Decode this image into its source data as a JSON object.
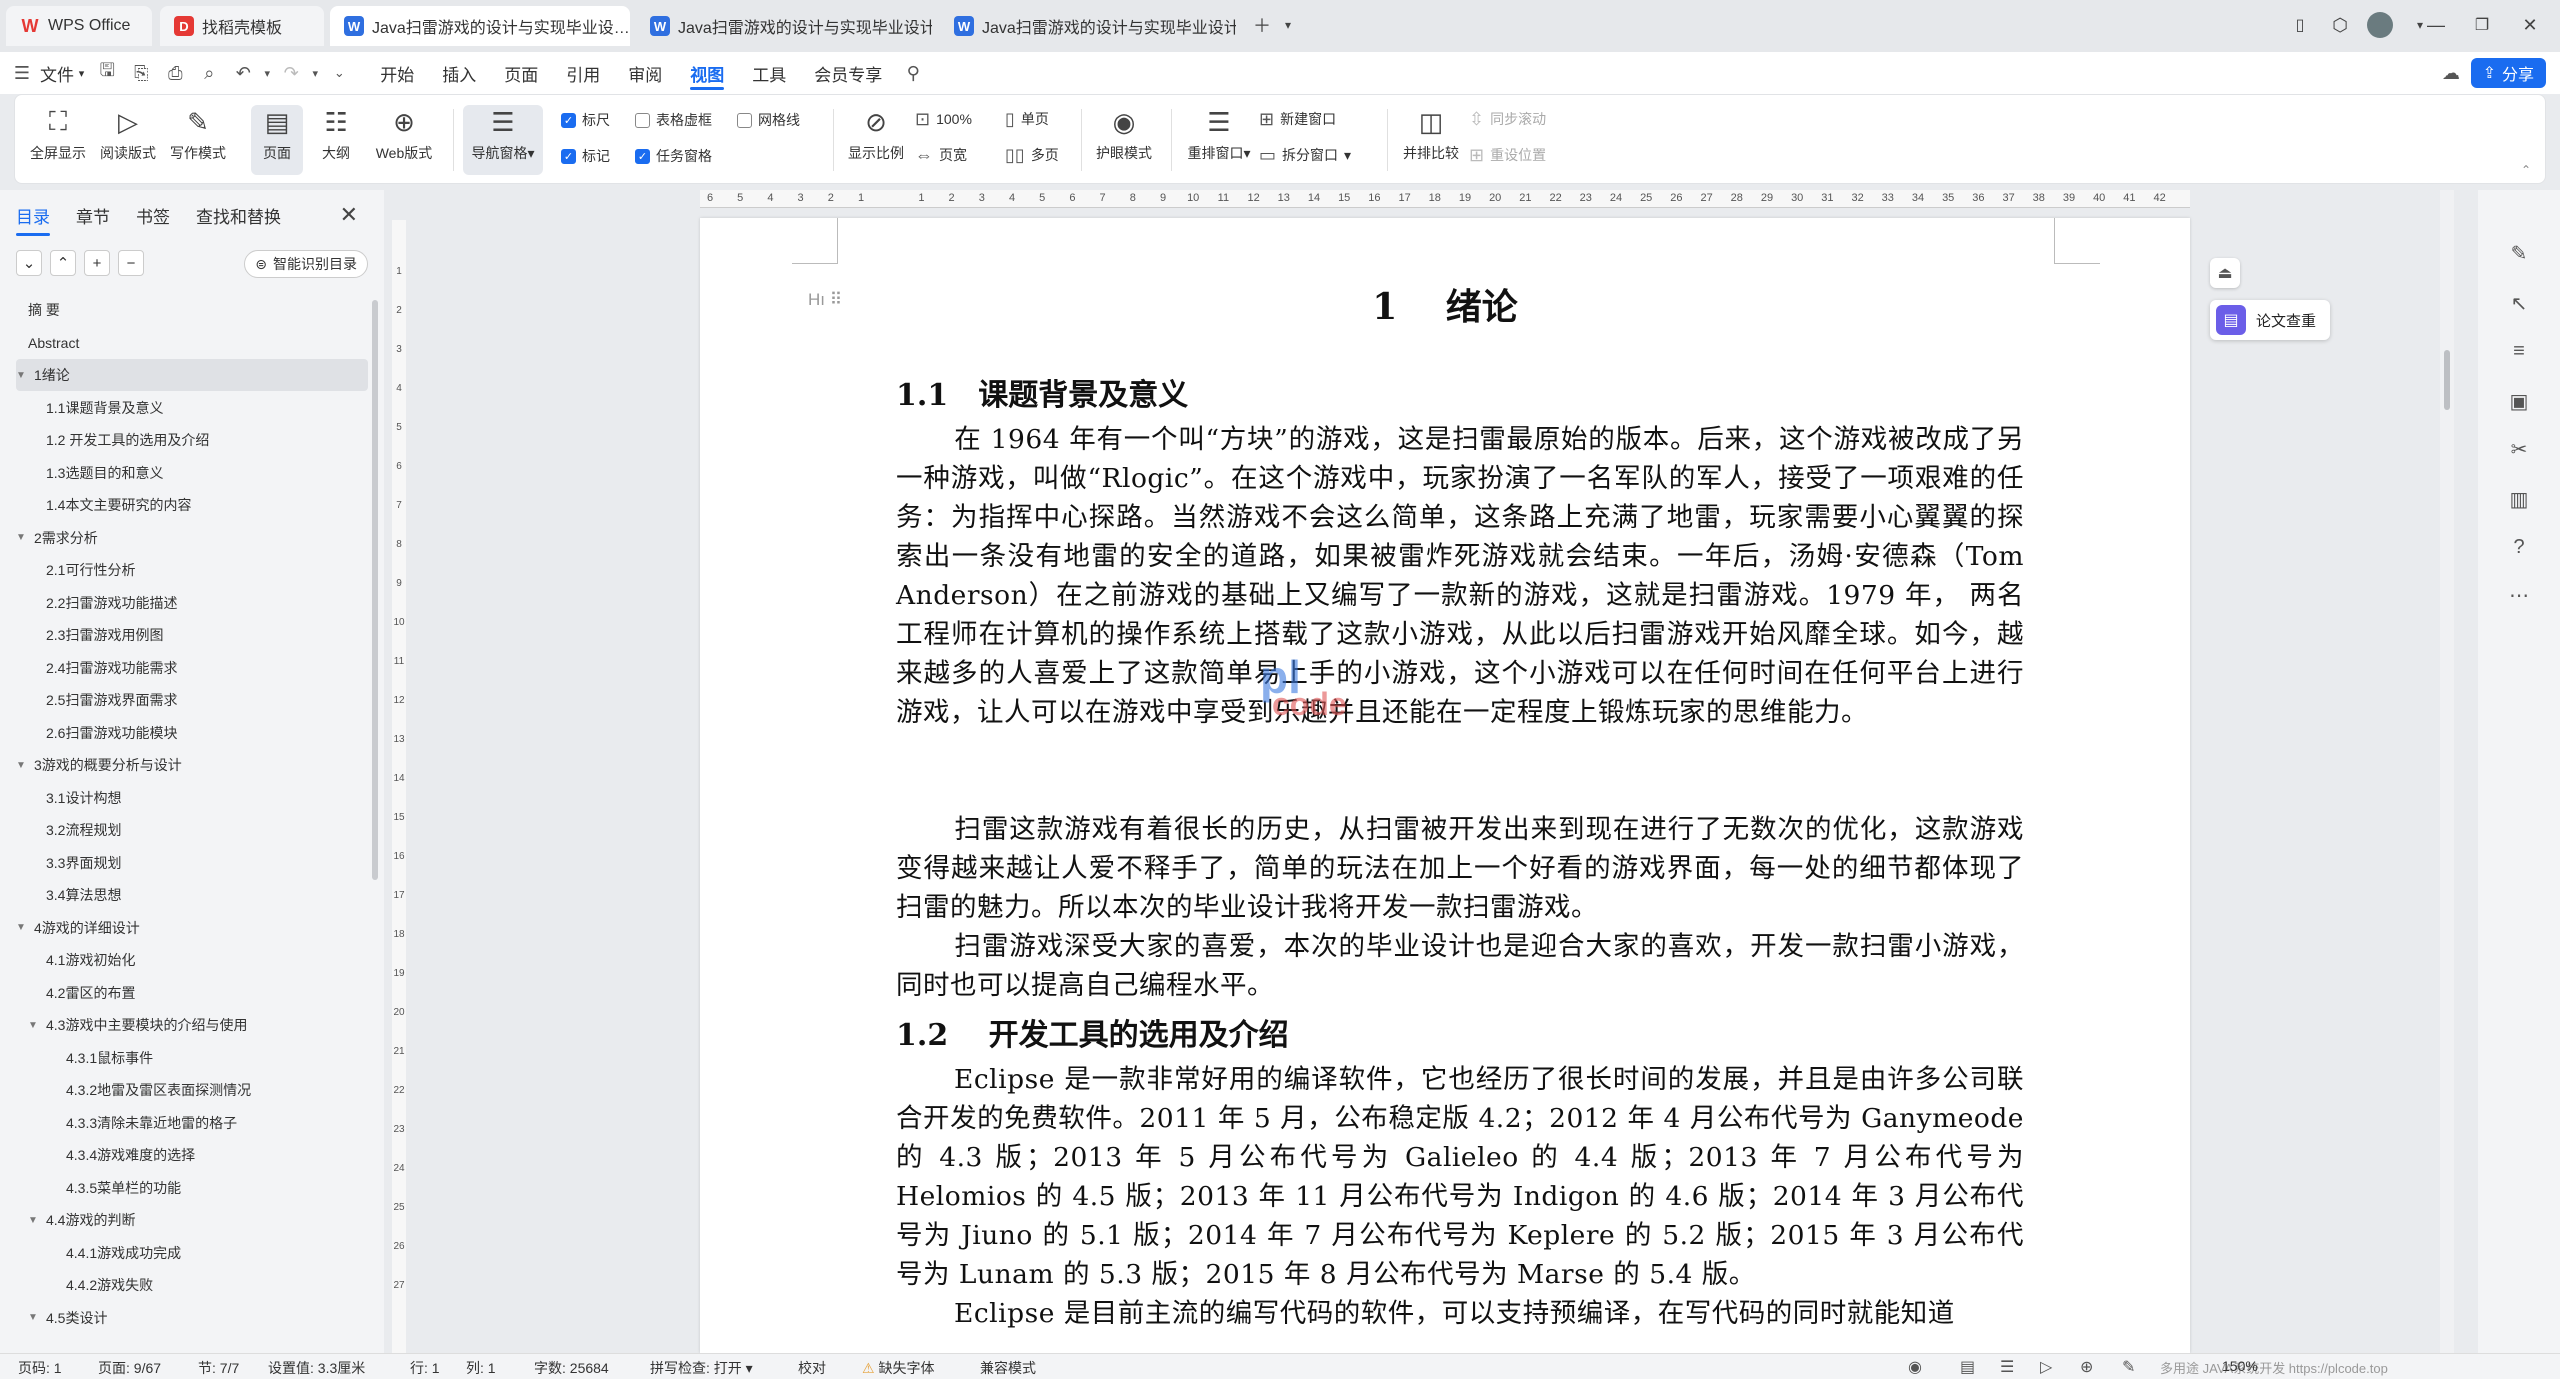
{
  "tabs": [
    {
      "label": "WPS Office",
      "icon": "wps-logo-icon",
      "color": "#e53935"
    },
    {
      "label": "找稻壳模板",
      "icon": "docer-icon",
      "color": "#e53935"
    },
    {
      "label": "Java扫雷游戏的设计与实现毕业设…",
      "icon": "word-doc-icon",
      "color": "#2f6fe0",
      "active": true
    },
    {
      "label": "Java扫雷游戏的设计与实现毕业设计…",
      "icon": "word-doc-icon",
      "color": "#2f6fe0"
    },
    {
      "label": "Java扫雷游戏的设计与实现毕业设计…",
      "icon": "word-doc-icon",
      "color": "#2f6fe0"
    }
  ],
  "menu": {
    "file": "文件",
    "items": [
      "开始",
      "插入",
      "页面",
      "引用",
      "审阅",
      "视图",
      "工具",
      "会员专享"
    ],
    "active": "视图",
    "share": "分享"
  },
  "ribbon": {
    "fullscreen": "全屏显示",
    "read_mode": "阅读版式",
    "write_mode": "写作模式",
    "page": "页面",
    "outline": "大纲",
    "web": "Web版式",
    "nav_pane": "导航窗格",
    "ruler": "标尺",
    "mark": "标记",
    "table_grid": "表格虚框",
    "task_pane": "任务窗格",
    "gridlines": "网格线",
    "zoom": "显示比例",
    "zoom_100": "100%",
    "page_width": "页宽",
    "single_page": "单页",
    "multi_page": "多页",
    "eye_mode": "护眼模式",
    "rearrange": "重排窗口",
    "new_window": "新建窗口",
    "split_window": "拆分窗口",
    "side_by_side": "并排比较",
    "sync_scroll": "同步滚动",
    "reset_pos": "重设位置"
  },
  "nav": {
    "tabs": [
      "目录",
      "章节",
      "书签",
      "查找和替换"
    ],
    "smart_toc": "智能识别目录",
    "items": [
      {
        "label": "摘  要",
        "level": 0
      },
      {
        "label": "Abstract",
        "level": 0
      },
      {
        "label": "1绪论",
        "level": 0,
        "expand": true,
        "selected": true
      },
      {
        "label": "1.1课题背景及意义",
        "level": 1
      },
      {
        "label": "1.2  开发工具的选用及介绍",
        "level": 1
      },
      {
        "label": "1.3选题目的和意义",
        "level": 1
      },
      {
        "label": "1.4本文主要研究的内容",
        "level": 1
      },
      {
        "label": "2需求分析",
        "level": 0,
        "expand": true
      },
      {
        "label": "2.1可行性分析",
        "level": 1
      },
      {
        "label": "2.2扫雷游戏功能描述",
        "level": 1
      },
      {
        "label": "2.3扫雷游戏用例图",
        "level": 1
      },
      {
        "label": "2.4扫雷游戏功能需求",
        "level": 1
      },
      {
        "label": "2.5扫雷游戏界面需求",
        "level": 1
      },
      {
        "label": "2.6扫雷游戏功能模块",
        "level": 1
      },
      {
        "label": "3游戏的概要分析与设计",
        "level": 0,
        "expand": true
      },
      {
        "label": "3.1设计构想",
        "level": 1
      },
      {
        "label": "3.2流程规划",
        "level": 1
      },
      {
        "label": "3.3界面规划",
        "level": 1
      },
      {
        "label": "3.4算法思想",
        "level": 1
      },
      {
        "label": "4游戏的详细设计",
        "level": 0,
        "expand": true
      },
      {
        "label": "4.1游戏初始化",
        "level": 1
      },
      {
        "label": "4.2雷区的布置",
        "level": 1
      },
      {
        "label": "4.3游戏中主要模块的介绍与使用",
        "level": 1,
        "expand": true
      },
      {
        "label": "4.3.1鼠标事件",
        "level": 2
      },
      {
        "label": "4.3.2地雷及雷区表面探测情况",
        "level": 2
      },
      {
        "label": "4.3.3清除未靠近地雷的格子",
        "level": 2
      },
      {
        "label": "4.3.4游戏难度的选择",
        "level": 2
      },
      {
        "label": "4.3.5菜单栏的功能",
        "level": 2
      },
      {
        "label": "4.4游戏的判断",
        "level": 1,
        "expand": true
      },
      {
        "label": "4.4.1游戏成功完成",
        "level": 2
      },
      {
        "label": "4.4.2游戏失败",
        "level": 2
      },
      {
        "label": "4.5类设计",
        "level": 1,
        "expand": true
      }
    ]
  },
  "ruler": {
    "h_ticks": [
      "6",
      "5",
      "4",
      "3",
      "2",
      "1",
      "",
      "1",
      "2",
      "3",
      "4",
      "5",
      "6",
      "7",
      "8",
      "9",
      "10",
      "11",
      "12",
      "13",
      "14",
      "15",
      "16",
      "17",
      "18",
      "19",
      "20",
      "21",
      "22",
      "23",
      "24",
      "25",
      "26",
      "27",
      "28",
      "29",
      "30",
      "31",
      "32",
      "33",
      "34",
      "35",
      "36",
      "37",
      "38",
      "39",
      "40",
      "41",
      "42"
    ],
    "v_ticks": [
      "1",
      "2",
      "3",
      "4",
      "5",
      "6",
      "7",
      "8",
      "9",
      "10",
      "11",
      "12",
      "13",
      "14",
      "15",
      "16",
      "17",
      "18",
      "19",
      "20",
      "21",
      "22",
      "23",
      "24",
      "25",
      "26",
      "27"
    ]
  },
  "doc": {
    "chapter_title": "1　 绪论",
    "heading_marker": "H",
    "h11": "1.1　课题背景及意义",
    "p1": "在 1964 年有一个叫“方块”的游戏，这是扫雷最原始的版本。后来，这个游戏被改成了另一种游戏，叫做“Rlogic”。在这个游戏中，玩家扮演了一名军队的军人，接受了一项艰难的任务：为指挥中心探路。当然游戏不会这么简单，这条路上充满了地雷，玩家需要小心翼翼的探索出一条没有地雷的安全的道路，如果被雷炸死游戏就会结束。一年后，汤姆·安德森（Tom Anderson）在之前游戏的基础上又编写了一款新的游戏，这就是扫雷游戏。1979 年， 两名工程师在计算机的操作系统上搭载了这款小游戏，从此以后扫雷游戏开始风靡全球。如今，越来越多的人喜爱上了这款简单易上手的小游戏，这个小游戏可以在任何时间在任何平台上进行游戏，让人可以在游戏中享受到乐趣并且还能在一定程度上锻炼玩家的思维能力。",
    "p2": "扫雷这款游戏有着很长的历史，从扫雷被开发出来到现在进行了无数次的优化，这款游戏变得越来越让人爱不释手了，简单的玩法在加上一个好看的游戏界面，每一处的细节都体现了扫雷的魅力。所以本次的毕业设计我将开发一款扫雷游戏。",
    "p3": "扫雷游戏深受大家的喜爱，本次的毕业设计也是迎合大家的喜欢，开发一款扫雷小游戏，同时也可以提高自己编程水平。",
    "h12": "1.2　 开发工具的选用及介绍",
    "p4": "Eclipse 是一款非常好用的编译软件，它也经历了很长时间的发展，并且是由许多公司联合开发的免费软件。2011 年 5 月，公布稳定版 4.2；2012 年 4 月公布代号为 Ganymeode 的 4.3 版；2013 年 5 月公布代号为 Galieleo 的 4.4 版；2013 年 7 月公布代号为 Helomios 的 4.5 版；2013 年 11 月公布代号为 Indigon 的 4.6 版；2014 年 3 月公布代号为 Jiuno 的 5.1 版；2014 年 7 月公布代号为 Keplere 的 5.2 版；2015 年 3 月公布代号为 Lunam 的 5.3 版；2015 年 8 月公布代号为 Marse 的 5.4 版。",
    "p5": "Eclipse 是目前主流的编写代码的软件，可以支持预编译，在写代码的同时就能知道",
    "watermark_top": "pl",
    "watermark_bottom": "code",
    "paper_check": "论文查重"
  },
  "status": {
    "page_no": "页码: 1",
    "page": "页面: 9/67",
    "section": "节: 7/7",
    "setting": "设置值: 3.3厘米",
    "row": "行: 1",
    "col": "列: 1",
    "words": "字数: 25684",
    "spell": "拼写检查: 打开",
    "proof": "校对",
    "missing_font": "缺失字体",
    "compat": "兼容模式",
    "zoom": "150%",
    "footer_text": "多用途 JAVA系统开发  https://plcode.top"
  }
}
